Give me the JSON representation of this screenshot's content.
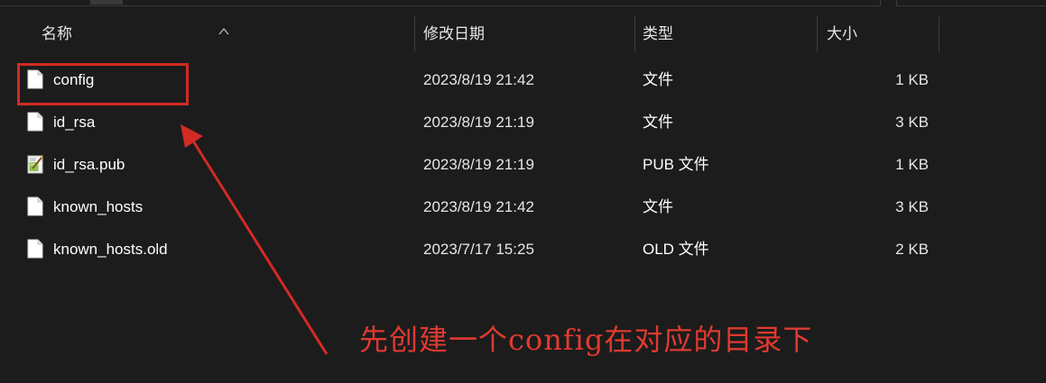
{
  "header": {
    "name": "名称",
    "modified": "修改日期",
    "type": "类型",
    "size": "大小"
  },
  "files": [
    {
      "name": "config",
      "modified": "2023/8/19 21:42",
      "type": "文件",
      "size": "1 KB",
      "icon": "file-icon"
    },
    {
      "name": "id_rsa",
      "modified": "2023/8/19 21:19",
      "type": "文件",
      "size": "3 KB",
      "icon": "file-icon"
    },
    {
      "name": "id_rsa.pub",
      "modified": "2023/8/19 21:19",
      "type": "PUB 文件",
      "size": "1 KB",
      "icon": "pub-file-icon"
    },
    {
      "name": "known_hosts",
      "modified": "2023/8/19 21:42",
      "type": "文件",
      "size": "3 KB",
      "icon": "file-icon"
    },
    {
      "name": "known_hosts.old",
      "modified": "2023/7/17 15:25",
      "type": "OLD 文件",
      "size": "2 KB",
      "icon": "file-icon"
    }
  ],
  "annotation": {
    "text": "先创建一个config在对应的目录下",
    "color": "#d42a24"
  }
}
